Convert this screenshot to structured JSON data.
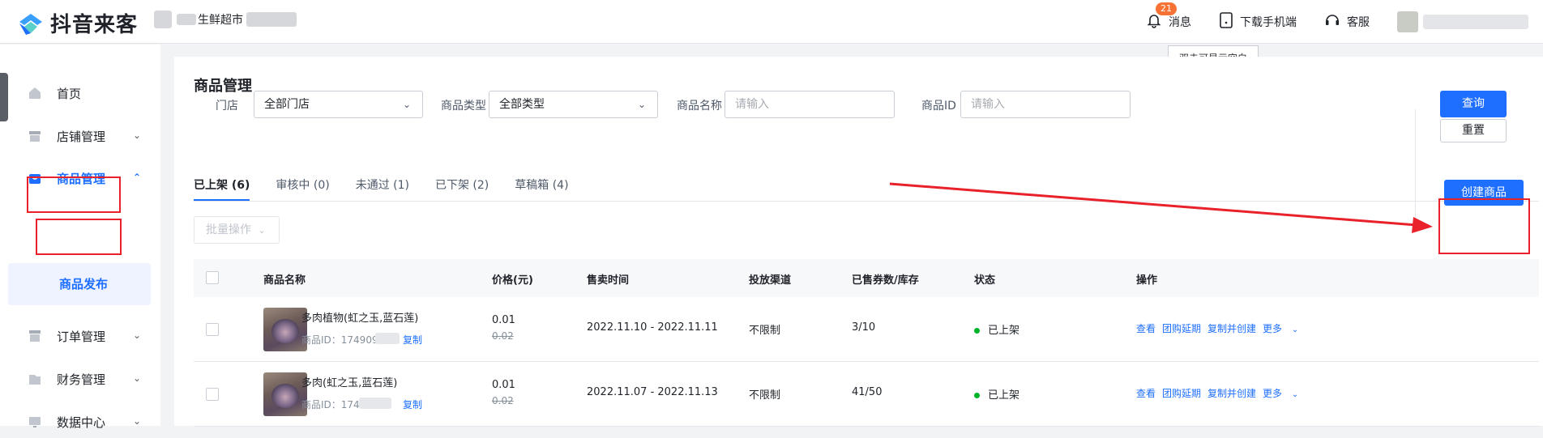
{
  "topbar": {
    "app_name": "抖音来客",
    "shop_name": "生鲜超市",
    "notif_count": "21",
    "messages": "消息",
    "download": "下载手机端",
    "support": "客服",
    "tooltip": "双击可显示空白"
  },
  "sidebar": {
    "items": [
      {
        "label": "首页"
      },
      {
        "label": "店铺管理"
      },
      {
        "label": "商品管理"
      },
      {
        "label": "订单管理"
      },
      {
        "label": "财务管理"
      },
      {
        "label": "数据中心"
      }
    ],
    "sub_item": "商品发布"
  },
  "main": {
    "title": "商品管理",
    "filters": {
      "store_label": "门店",
      "store_value": "全部门店",
      "type_label": "商品类型",
      "type_value": "全部类型",
      "name_label": "商品名称",
      "name_placeholder": "请输入",
      "id_label": "商品ID",
      "id_placeholder": "请输入"
    },
    "query_button": "查询",
    "reset_button": "重置",
    "tabs": [
      "已上架 (6)",
      "审核中 (0)",
      "未通过 (1)",
      "已下架 (2)",
      "草稿箱 (4)"
    ],
    "batch_button": "批量操作",
    "create_button": "创建商品",
    "columns": [
      "商品名称",
      "价格(元)",
      "售卖时间",
      "投放渠道",
      "已售券数/库存",
      "状态",
      "操作"
    ],
    "rows": [
      {
        "name": "多肉植物(虹之玉,蓝石莲)",
        "id": "商品ID：174909676",
        "copy": "复制",
        "price": "0.01",
        "orig_price": "0.02",
        "time": "2022.11.10 - 2022.11.11",
        "channel": "不限制",
        "sold": "3/10",
        "status": "已上架",
        "ops": [
          "查看",
          "团购延期",
          "复制并创建",
          "更多"
        ]
      },
      {
        "name": "多肉(虹之玉,蓝石莲)",
        "id": "商品ID：1748835",
        "copy": "复制",
        "price": "0.01",
        "orig_price": "0.02",
        "time": "2022.11.07 - 2022.11.13",
        "channel": "不限制",
        "sold": "41/50",
        "status": "已上架",
        "ops": [
          "查看",
          "团购延期",
          "复制并创建",
          "更多"
        ]
      }
    ]
  },
  "colors": {
    "accent": "#1e6fff",
    "annotation_red": "#e8212a",
    "status_green": "#00b42a"
  }
}
